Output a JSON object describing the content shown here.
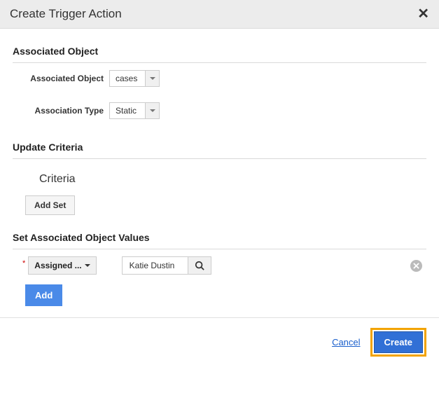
{
  "header": {
    "title": "Create Trigger Action"
  },
  "sections": {
    "associated_object": "Associated Object",
    "update_criteria": "Update Criteria",
    "set_values": "Set Associated Object Values"
  },
  "form": {
    "assoc_object_label": "Associated Object",
    "assoc_object_value": "cases",
    "assoc_type_label": "Association Type",
    "assoc_type_value": "Static"
  },
  "criteria": {
    "label": "Criteria",
    "add_set": "Add Set"
  },
  "values_row": {
    "field_select": "Assigned ...",
    "input_value": "Katie Dustin"
  },
  "buttons": {
    "add": "Add",
    "cancel": "Cancel",
    "create": "Create"
  }
}
